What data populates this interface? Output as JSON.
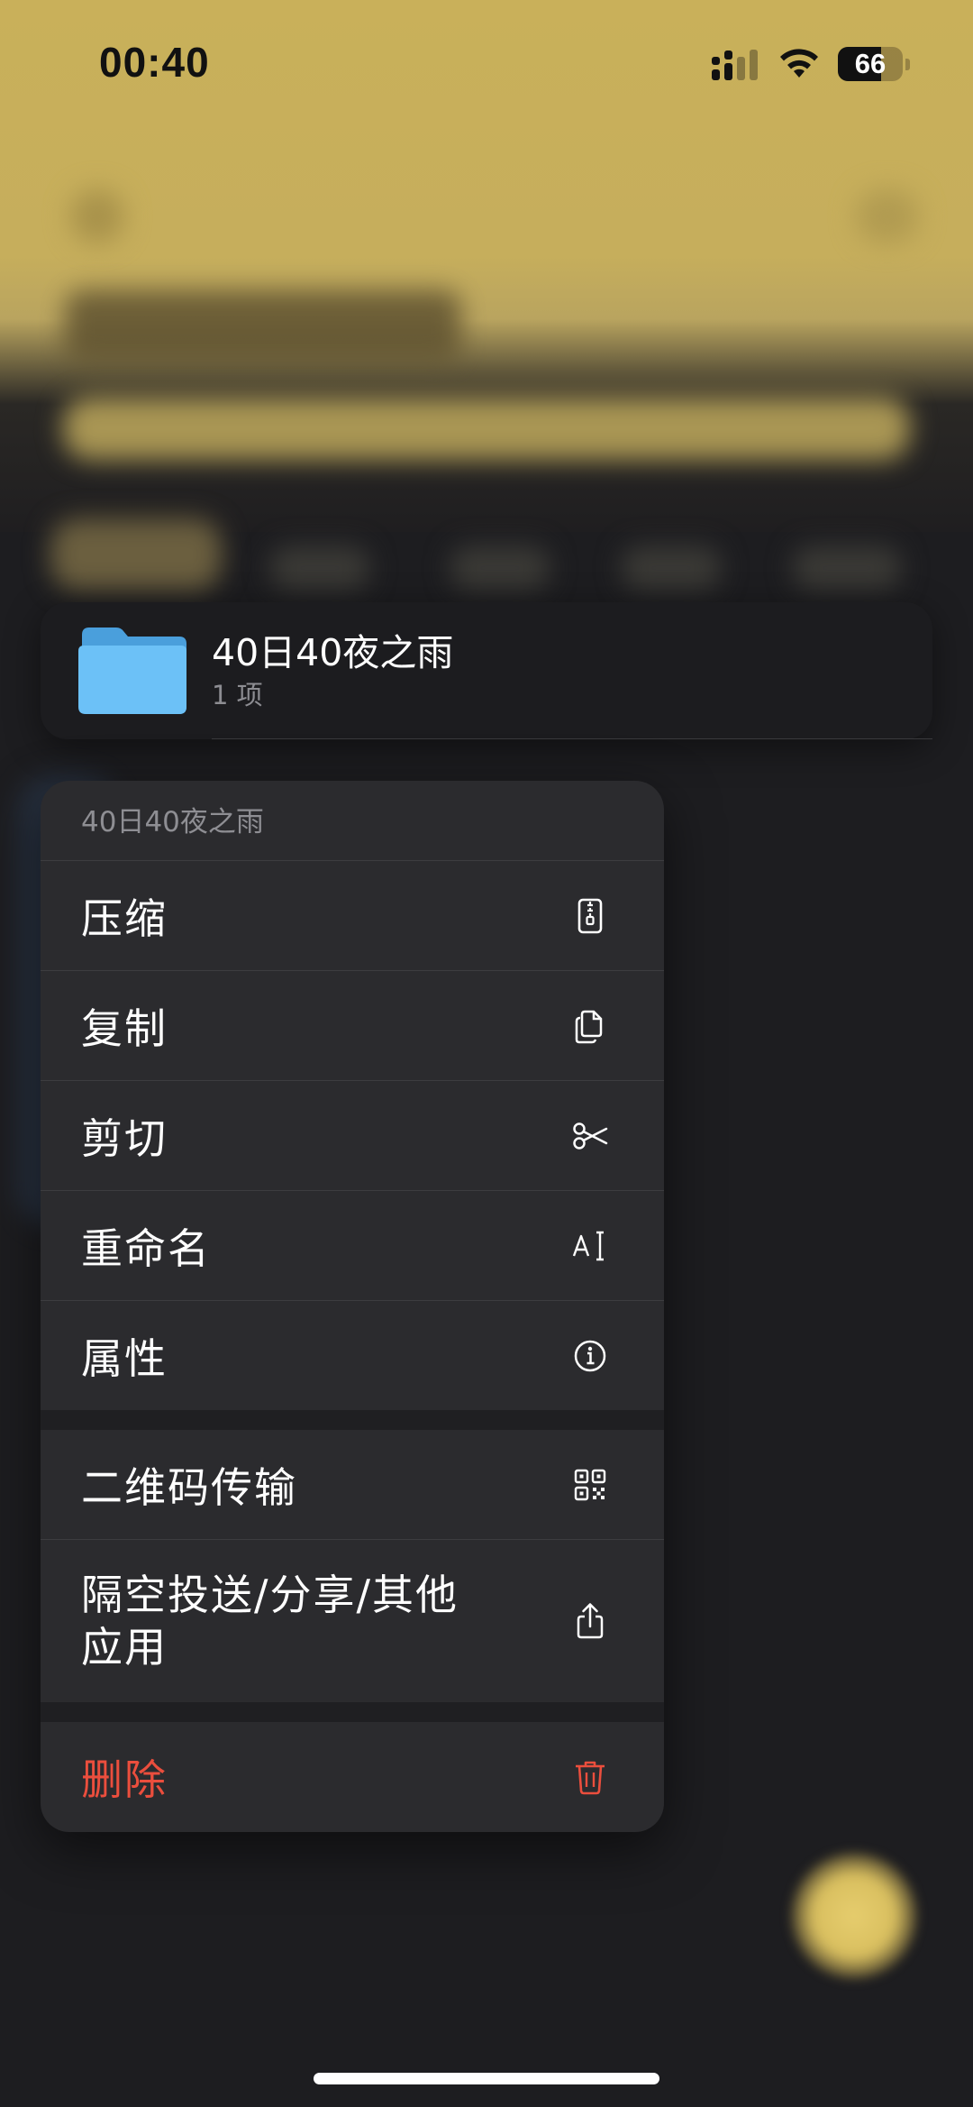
{
  "status_bar": {
    "time": "00:40",
    "battery_level": "66",
    "battery_fraction": 0.66,
    "icons": [
      "cellular-signal-icon",
      "wifi-icon",
      "battery-icon"
    ]
  },
  "preview": {
    "folder_name": "40日40夜之雨",
    "item_count": "1 项",
    "icon": "folder-icon"
  },
  "menu": {
    "header": "40日40夜之雨",
    "items": [
      {
        "label": "压缩",
        "icon": "zip-archive-icon"
      },
      {
        "label": "复制",
        "icon": "copy-icon"
      },
      {
        "label": "剪切",
        "icon": "scissors-icon"
      },
      {
        "label": "重命名",
        "icon": "rename-icon"
      },
      {
        "label": "属性",
        "icon": "info-icon"
      }
    ],
    "group2": [
      {
        "label": "二维码传输",
        "icon": "qr-code-icon"
      },
      {
        "label": "隔空投送/分享/其他应用",
        "icon": "share-icon"
      }
    ],
    "delete": {
      "label": "删除",
      "icon": "trash-icon"
    }
  },
  "colors": {
    "destructive": "#eb4e3d",
    "menu_background": "#2b2b2e",
    "folder_blue": "#5ab4f0",
    "background_accent": "#c9b05a"
  }
}
